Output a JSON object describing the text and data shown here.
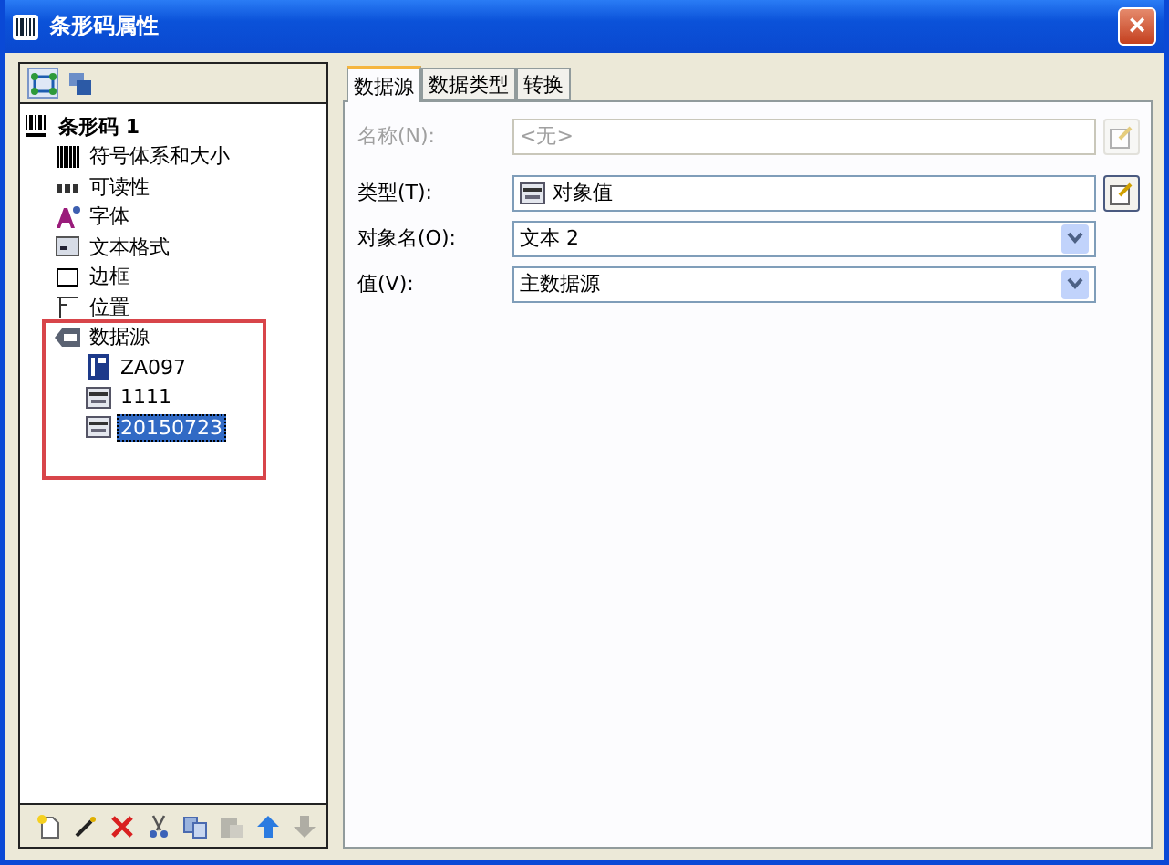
{
  "window": {
    "title": "条形码属性",
    "close": "×"
  },
  "tree_toolbar": [
    {
      "kind": "fit",
      "selected": true
    },
    {
      "kind": "layers",
      "selected": false
    }
  ],
  "tree": [
    {
      "label": "条形码 1",
      "kind": "barcode",
      "selected": false,
      "children": [
        {
          "label": "符号体系和大小",
          "kind": "bars",
          "selected": false
        },
        {
          "label": "可读性",
          "kind": "digits",
          "selected": false
        },
        {
          "label": "字体",
          "kind": "font",
          "selected": false
        },
        {
          "label": "文本格式",
          "kind": "format",
          "selected": false
        },
        {
          "label": "边框",
          "kind": "border",
          "selected": false
        },
        {
          "label": "位置",
          "kind": "position",
          "selected": false
        },
        {
          "label": "数据源",
          "kind": "source",
          "selected": false,
          "highlighted": true,
          "children": [
            {
              "label": "ZA097",
              "kind": "database",
              "selected": false
            },
            {
              "label": "1111",
              "kind": "variable",
              "selected": false
            },
            {
              "label": "20150723",
              "kind": "variable",
              "selected": true
            }
          ]
        }
      ]
    }
  ],
  "bottom_toolbar": [
    {
      "kind": "new",
      "disabled": false
    },
    {
      "kind": "wand",
      "disabled": false
    },
    {
      "kind": "delete",
      "disabled": false
    },
    {
      "kind": "cut",
      "disabled": false
    },
    {
      "kind": "copy",
      "disabled": false
    },
    {
      "kind": "paste",
      "disabled": true
    },
    {
      "kind": "up",
      "disabled": false
    },
    {
      "kind": "down",
      "disabled": true
    }
  ],
  "tabs": [
    {
      "label": "数据源",
      "selected": true
    },
    {
      "label": "数据类型",
      "selected": false
    },
    {
      "label": "转换",
      "selected": false
    }
  ],
  "fields": [
    {
      "label": "名称(N):",
      "kind": "text",
      "disabled": true,
      "placeholder": "<无>",
      "side_button": true
    },
    {
      "label": "类型(T):",
      "kind": "typed",
      "disabled": false,
      "value": "对象值",
      "side_button": true
    },
    {
      "label": "对象名(O):",
      "kind": "select",
      "disabled": false,
      "value": "文本 2"
    },
    {
      "label": "值(V):",
      "kind": "select",
      "disabled": false,
      "value": "主数据源"
    }
  ]
}
